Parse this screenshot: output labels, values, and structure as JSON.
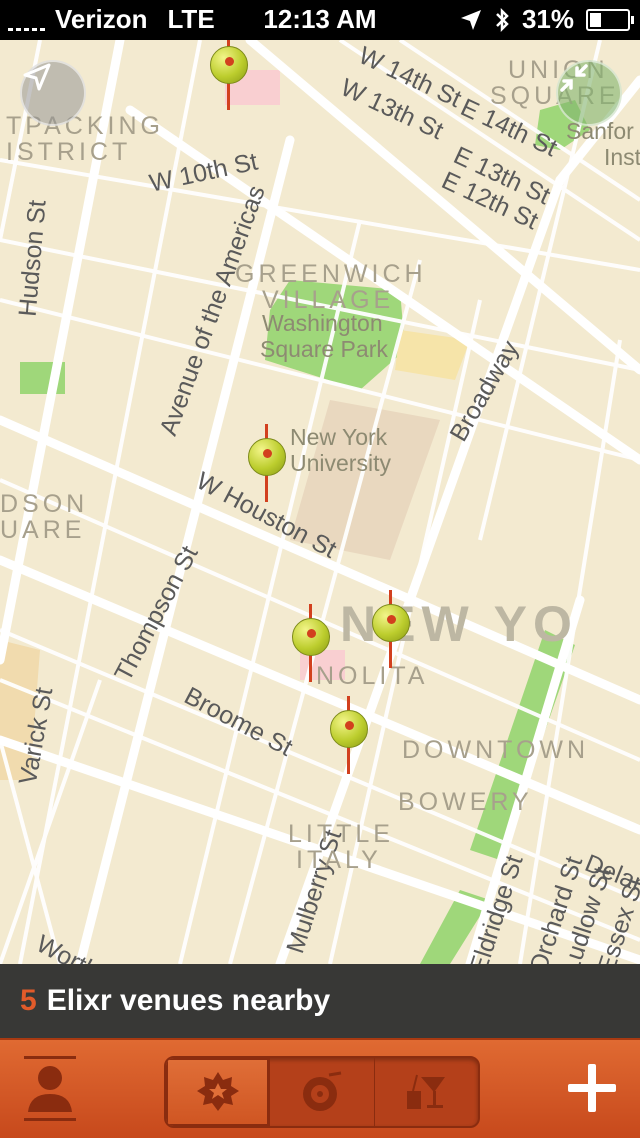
{
  "status": {
    "carrier": "Verizon",
    "network": "LTE",
    "time": "12:13 AM",
    "battery": "31%",
    "battery_level": 0.31
  },
  "map": {
    "streets": [
      "W 14th St",
      "W 13th St",
      "E 14th St",
      "E 13th St",
      "E 12th St",
      "W 10th St",
      "Hudson St",
      "Avenue of the Americas",
      "Broadway",
      "W Houston St",
      "Thompson St",
      "Broome St",
      "Varick St",
      "Mulberry St",
      "Worth St",
      "Eldridge St",
      "Orchard St",
      "Ludlow St",
      "Essex St",
      "Delan"
    ],
    "areas": {
      "union_square_1": "UNION",
      "union_square_2": "SQUARE",
      "meatpacking_1": "TPACKING",
      "meatpacking_2": "ISTRICT",
      "greenwich_1": "GREENWICH",
      "greenwich_2": "VILLAGE",
      "hudson_sq_1": "DSON",
      "hudson_sq_2": "UARE",
      "nolita": "NOLITA",
      "downtown": "DOWNTOWN",
      "bowery": "BOWERY",
      "little_italy_1": "LITTLE",
      "little_italy_2": "ITALY",
      "new_york": "NEW YO"
    },
    "places": {
      "washington_sq_1": "Washington",
      "washington_sq_2": "Square Park",
      "nyu_1": "New York",
      "nyu_2": "University",
      "sanford_1": "Sanfor",
      "sanford_2": "Inst"
    },
    "pins_count": 5
  },
  "banner": {
    "count": "5",
    "text": "Elixr venues nearby"
  },
  "tabbar": {
    "profile_icon": "person-icon",
    "tabs": [
      {
        "icon": "badge-star-icon",
        "active": true
      },
      {
        "icon": "record-icon",
        "active": false
      },
      {
        "icon": "drinks-icon",
        "active": false
      }
    ],
    "add_icon": "plus-icon"
  },
  "colors": {
    "accent": "#d2541f",
    "map_bg": "#f3ead0",
    "park": "#8fd16a",
    "pin": "#bccd2d"
  }
}
